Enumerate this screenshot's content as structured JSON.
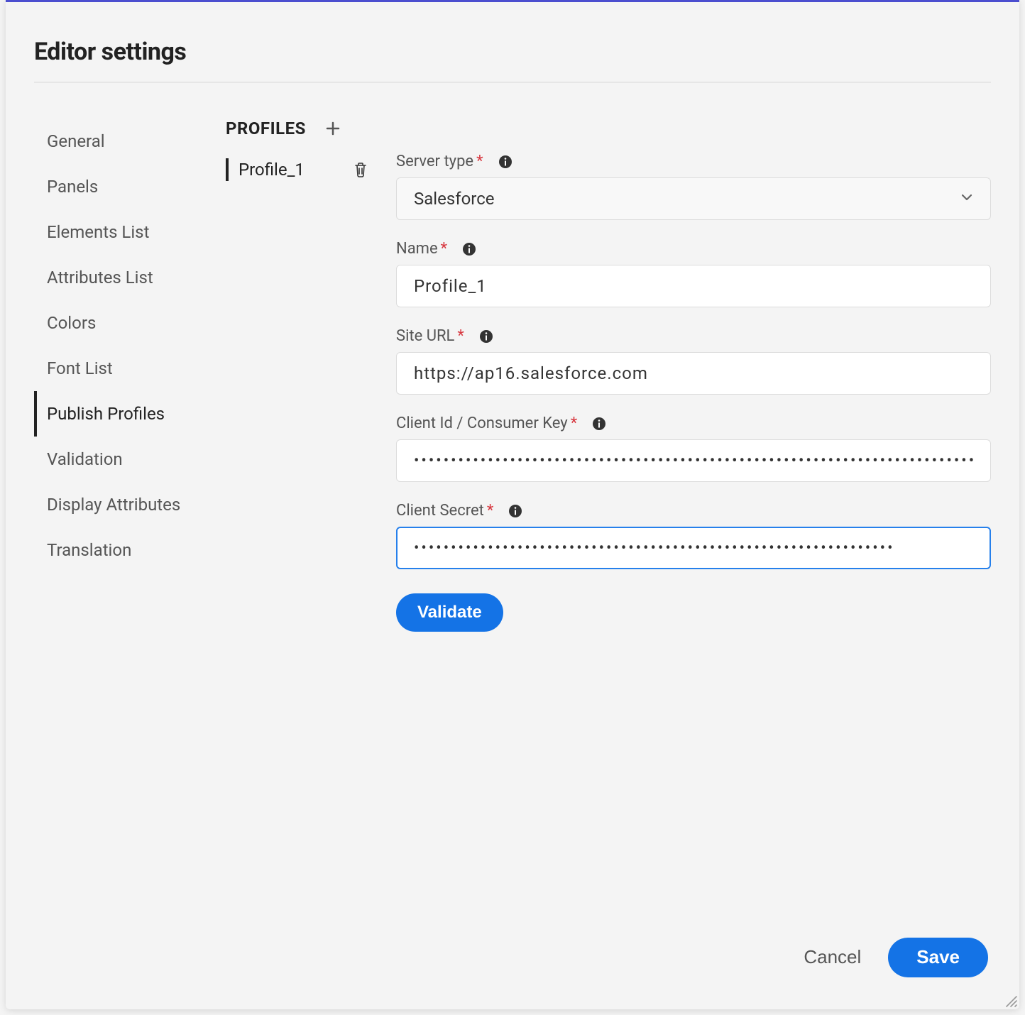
{
  "header": {
    "title": "Editor settings"
  },
  "nav": {
    "items": [
      {
        "label": "General"
      },
      {
        "label": "Panels"
      },
      {
        "label": "Elements List"
      },
      {
        "label": "Attributes List"
      },
      {
        "label": "Colors"
      },
      {
        "label": "Font List"
      },
      {
        "label": "Publish Profiles"
      },
      {
        "label": "Validation"
      },
      {
        "label": "Display Attributes"
      },
      {
        "label": "Translation"
      }
    ],
    "active_index": 6
  },
  "profiles": {
    "heading": "PROFILES",
    "items": [
      {
        "name": "Profile_1"
      }
    ]
  },
  "form": {
    "server_type": {
      "label": "Server type",
      "value": "Salesforce"
    },
    "name": {
      "label": "Name",
      "value": "Profile_1"
    },
    "site_url": {
      "label": "Site URL",
      "value": "https://ap16.salesforce.com"
    },
    "client_id": {
      "label": "Client Id / Consumer Key",
      "value": "••••••••••••••••••••••••••••••••••••••••••••••••••••••••••••••••••••••••••••••••••••••"
    },
    "client_secret": {
      "label": "Client Secret",
      "value": "•••••••••••••••••••••••••••••••••••••••••••••••••••••••••••••••••"
    },
    "validate_label": "Validate"
  },
  "footer": {
    "cancel_label": "Cancel",
    "save_label": "Save"
  }
}
